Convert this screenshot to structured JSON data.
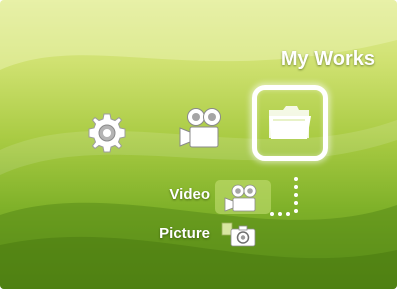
{
  "screen": {
    "title": "My Works",
    "colors": {
      "background_top": "#e3ee9a",
      "background_bottom": "#5e9319",
      "highlight": "#ffffff"
    }
  },
  "menu": {
    "items": [
      {
        "icon": "gear-icon",
        "selected": false
      },
      {
        "icon": "camcorder-icon",
        "selected": false
      },
      {
        "icon": "folder-icon",
        "selected": true
      }
    ]
  },
  "submenu": {
    "items": [
      {
        "label": "Video",
        "icon": "video-camera-icon",
        "highlighted": true
      },
      {
        "label": "Picture",
        "icon": "camera-icon",
        "highlighted": false
      }
    ]
  }
}
